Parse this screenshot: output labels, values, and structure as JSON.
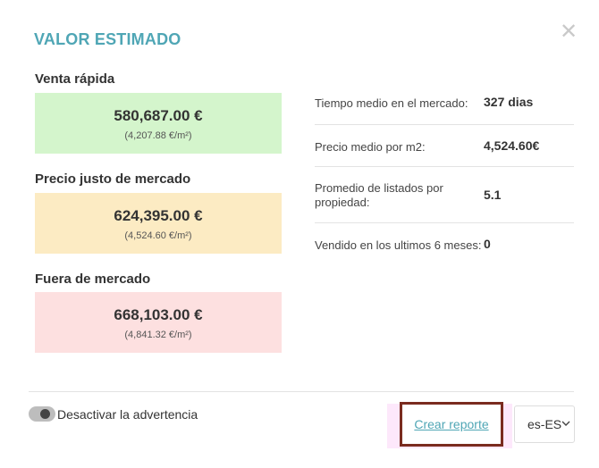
{
  "header": {
    "title": "VALOR ESTIMADO",
    "close_glyph": "✕"
  },
  "estimates": [
    {
      "label": "Venta rápida",
      "amount": "580,687.00 €",
      "per_m2": "(4,207.88 €/m²)",
      "color": "#d4f5cc"
    },
    {
      "label": "Precio justo de mercado",
      "amount": "624,395.00 €",
      "per_m2": "(4,524.60 €/m²)",
      "color": "#fcebc3"
    },
    {
      "label": "Fuera de mercado",
      "amount": "668,103.00 €",
      "per_m2": "(4,841.32 €/m²)",
      "color": "#fde0e0"
    }
  ],
  "stats": [
    {
      "label": "Tiempo medio en el mercado:",
      "value": "327 dias"
    },
    {
      "label": "Precio medio por m2:",
      "value": "4,524.60€"
    },
    {
      "label": "Promedio de listados por propiedad:",
      "value": "5.1"
    },
    {
      "label": "Vendido en los ultimos 6 meses:",
      "value": "0"
    }
  ],
  "footer": {
    "toggle_label": "Desactivar la advertencia",
    "report_label": "Crear reporte",
    "language": "es-ES"
  },
  "colors": {
    "accent": "#4fa6b5",
    "highlight_border": "#7a2b1f"
  }
}
